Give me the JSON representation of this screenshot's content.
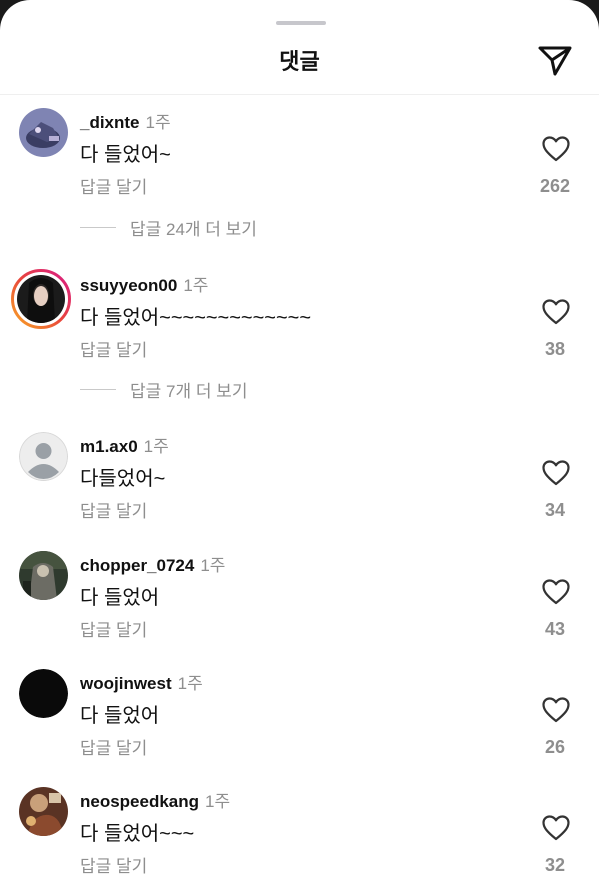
{
  "header": {
    "title": "댓글",
    "share_icon": "paper-plane-icon"
  },
  "reply_label": "답글 달기",
  "comments": [
    {
      "username": "_dixnte",
      "time": "1주",
      "text": "다 들었어~",
      "likes": "262",
      "view_replies": "답글 24개 더 보기"
    },
    {
      "username": "ssuyyeon00",
      "time": "1주",
      "text": "다 들었어~~~~~~~~~~~~~",
      "likes": "38",
      "view_replies": "답글 7개 더 보기"
    },
    {
      "username": "m1.ax0",
      "time": "1주",
      "text": "다들었어~",
      "likes": "34"
    },
    {
      "username": "chopper_0724",
      "time": "1주",
      "text": "다 들었어",
      "likes": "43"
    },
    {
      "username": "woojinwest",
      "time": "1주",
      "text": "다 들었어",
      "likes": "26"
    },
    {
      "username": "neospeedkang",
      "time": "1주",
      "text": "다 들었어~~~",
      "likes": "32"
    }
  ],
  "colors": {
    "story_ring_start": "#f9a825",
    "story_ring_end": "#d81b88",
    "secondary_text": "#8e8e8e"
  }
}
